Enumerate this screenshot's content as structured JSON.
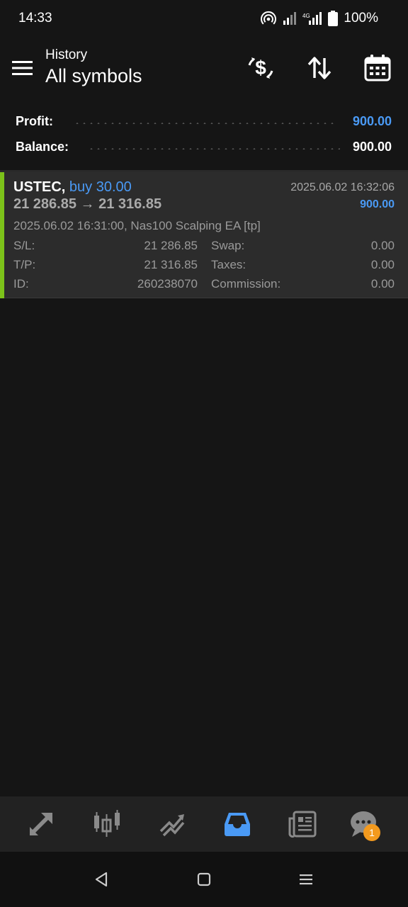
{
  "status_bar": {
    "time": "14:33",
    "network": "4G",
    "battery": "100%",
    "icons": [
      "hotspot-icon",
      "signal-icon",
      "signal-4g-icon",
      "battery-icon"
    ]
  },
  "header": {
    "subtitle": "History",
    "title": "All symbols",
    "icons": [
      "menu-icon",
      "currency-exchange-icon",
      "sort-icon",
      "calendar-icon"
    ]
  },
  "summary": {
    "profit_label": "Profit:",
    "profit_value": "900.00",
    "balance_label": "Balance:",
    "balance_value": "900.00"
  },
  "deal": {
    "symbol": "USTEC,",
    "side": "buy 30.00",
    "price_open": "21 286.85",
    "arrow": "→",
    "price_close": "21 316.85",
    "close_time": "2025.06.02 16:32:06",
    "profit": "900.00",
    "comment": "2025.06.02 16:31:00, Nas100 Scalping EA [tp]",
    "sl_label": "S/L:",
    "sl_value": "21 286.85",
    "tp_label": "T/P:",
    "tp_value": "21 316.85",
    "id_label": "ID:",
    "id_value": "260238070",
    "swap_label": "Swap:",
    "swap_value": "0.00",
    "taxes_label": "Taxes:",
    "taxes_value": "0.00",
    "commission_label": "Commission:",
    "commission_value": "0.00"
  },
  "bottom_nav": {
    "items": [
      "quotes-icon",
      "chart-icon",
      "trade-icon",
      "history-icon",
      "news-icon",
      "chat-icon"
    ],
    "active": "history-icon",
    "chat_badge": "1"
  },
  "colors": {
    "background": "#151515",
    "accent_blue": "#4a9af5",
    "buy_bar": "#7cc21a",
    "badge": "#f39a1e"
  }
}
